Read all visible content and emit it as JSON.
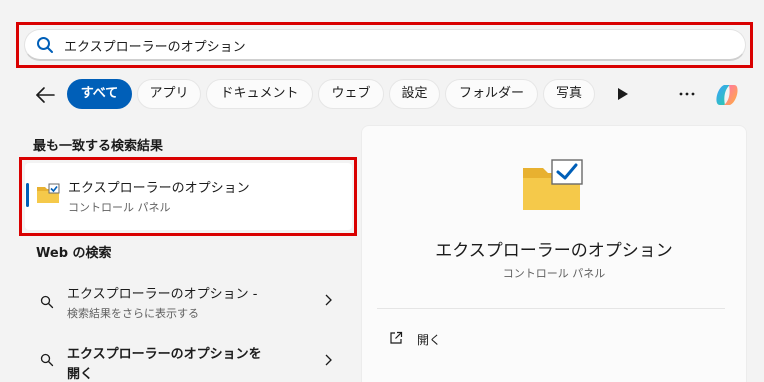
{
  "search": {
    "query": "エクスプローラーのオプション",
    "icon": "search-icon"
  },
  "filters": {
    "back_icon": "back-arrow-icon",
    "chips": [
      "すべて",
      "アプリ",
      "ドキュメント",
      "ウェブ",
      "設定",
      "フォルダー",
      "写真"
    ],
    "active_index": 0,
    "play_icon": "play-icon",
    "more_label": "···",
    "copilot_icon": "copilot-icon"
  },
  "best_match": {
    "heading": "最も一致する検索結果",
    "title": "エクスプローラーのオプション",
    "subtitle": "コントロール パネル",
    "icon": "folder-options-icon"
  },
  "web": {
    "heading": "Web の検索",
    "items": [
      {
        "title": "エクスプローラーのオプション -",
        "subtitle": "検索結果をさらに表示する"
      },
      {
        "title": "エクスプローラーのオプションを",
        "title_line2": "開く",
        "subtitle": ""
      }
    ]
  },
  "detail": {
    "title": "エクスプローラーのオプション",
    "subtitle": "コントロール パネル",
    "actions": [
      {
        "label": "開く",
        "icon": "open-external-icon"
      }
    ]
  },
  "colors": {
    "accent": "#005fb8",
    "highlight_outline": "#d90000",
    "folder_yellow": "#f5c94a"
  }
}
